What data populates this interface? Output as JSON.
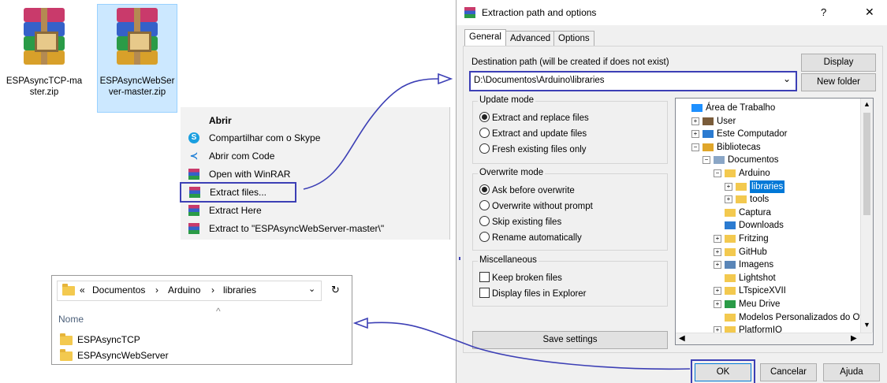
{
  "desktop": {
    "files": [
      {
        "name_line1": "ESPAsyncTCP-ma",
        "name_line2": "ster.zip"
      },
      {
        "name_line1": "ESPAsyncWebSer",
        "name_line2": "ver-master.zip"
      }
    ]
  },
  "context_menu": {
    "header": "Abrir",
    "items": [
      {
        "label": "Compartilhar com o Skype",
        "icon": "skype-icon"
      },
      {
        "label": "Abrir com Code",
        "icon": "vscode-icon"
      },
      {
        "label": "Open with WinRAR",
        "icon": "winrar-icon"
      },
      {
        "label": "Extract files...",
        "icon": "winrar-icon"
      },
      {
        "label": "Extract Here",
        "icon": "winrar-icon"
      },
      {
        "label": "Extract to \"ESPAsyncWebServer-master\\\"",
        "icon": "winrar-icon"
      }
    ]
  },
  "explorer": {
    "path_prefix": "«",
    "crumbs": [
      "Documentos",
      "Arduino",
      "libraries"
    ],
    "separator": "›",
    "column_header": "Nome",
    "sort_glyph": "^",
    "items": [
      "ESPAsyncTCP",
      "ESPAsyncWebServer"
    ]
  },
  "dialog": {
    "title": "Extraction path and options",
    "help": "?",
    "close": "✕",
    "tabs": [
      "General",
      "Advanced",
      "Options"
    ],
    "dest_label": "Destination path (will be created if does not exist)",
    "dest_value": "D:\\Documentos\\Arduino\\libraries",
    "display_btn": "Display",
    "new_folder_btn": "New folder",
    "update_mode": {
      "title": "Update mode",
      "options": [
        "Extract and replace files",
        "Extract and update files",
        "Fresh existing files only"
      ],
      "selected": 0
    },
    "overwrite_mode": {
      "title": "Overwrite mode",
      "options": [
        "Ask before overwrite",
        "Overwrite without prompt",
        "Skip existing files",
        "Rename automatically"
      ],
      "selected": 0
    },
    "misc": {
      "title": "Miscellaneous",
      "options": [
        "Keep broken files",
        "Display files in Explorer"
      ]
    },
    "save_settings": "Save settings",
    "tree": [
      {
        "label": "Área de Trabalho",
        "level": 0,
        "expander": "",
        "icon": "desktop-icon"
      },
      {
        "label": "User",
        "level": 1,
        "expander": "+",
        "icon": "user-icon"
      },
      {
        "label": "Este Computador",
        "level": 1,
        "expander": "+",
        "icon": "computer-icon"
      },
      {
        "label": "Bibliotecas",
        "level": 1,
        "expander": "−",
        "icon": "library-icon"
      },
      {
        "label": "Documentos",
        "level": 2,
        "expander": "−",
        "icon": "documents-icon"
      },
      {
        "label": "Arduino",
        "level": 3,
        "expander": "−",
        "icon": "folder-icon"
      },
      {
        "label": "libraries",
        "level": 4,
        "expander": "+",
        "icon": "folder-icon",
        "selected": true
      },
      {
        "label": "tools",
        "level": 4,
        "expander": "+",
        "icon": "folder-icon"
      },
      {
        "label": "Captura",
        "level": 3,
        "expander": "",
        "icon": "folder-icon"
      },
      {
        "label": "Downloads",
        "level": 3,
        "expander": "",
        "icon": "download-icon"
      },
      {
        "label": "Fritzing",
        "level": 3,
        "expander": "+",
        "icon": "folder-icon"
      },
      {
        "label": "GitHub",
        "level": 3,
        "expander": "+",
        "icon": "folder-icon"
      },
      {
        "label": "Imagens",
        "level": 3,
        "expander": "+",
        "icon": "pictures-icon"
      },
      {
        "label": "Lightshot",
        "level": 3,
        "expander": "",
        "icon": "folder-icon"
      },
      {
        "label": "LTspiceXVII",
        "level": 3,
        "expander": "+",
        "icon": "folder-icon"
      },
      {
        "label": "Meu Drive",
        "level": 3,
        "expander": "+",
        "icon": "drive-icon"
      },
      {
        "label": "Modelos Personalizados do Of",
        "level": 3,
        "expander": "",
        "icon": "folder-icon"
      },
      {
        "label": "PlatformIO",
        "level": 3,
        "expander": "+",
        "icon": "folder-icon"
      }
    ],
    "ok_btn": "OK",
    "cancel_btn": "Cancelar",
    "help_btn": "Ajuda"
  },
  "colors": {
    "highlight": "#3c3fb5",
    "selection": "#cce8ff",
    "tree_selected": "#0078d7"
  }
}
